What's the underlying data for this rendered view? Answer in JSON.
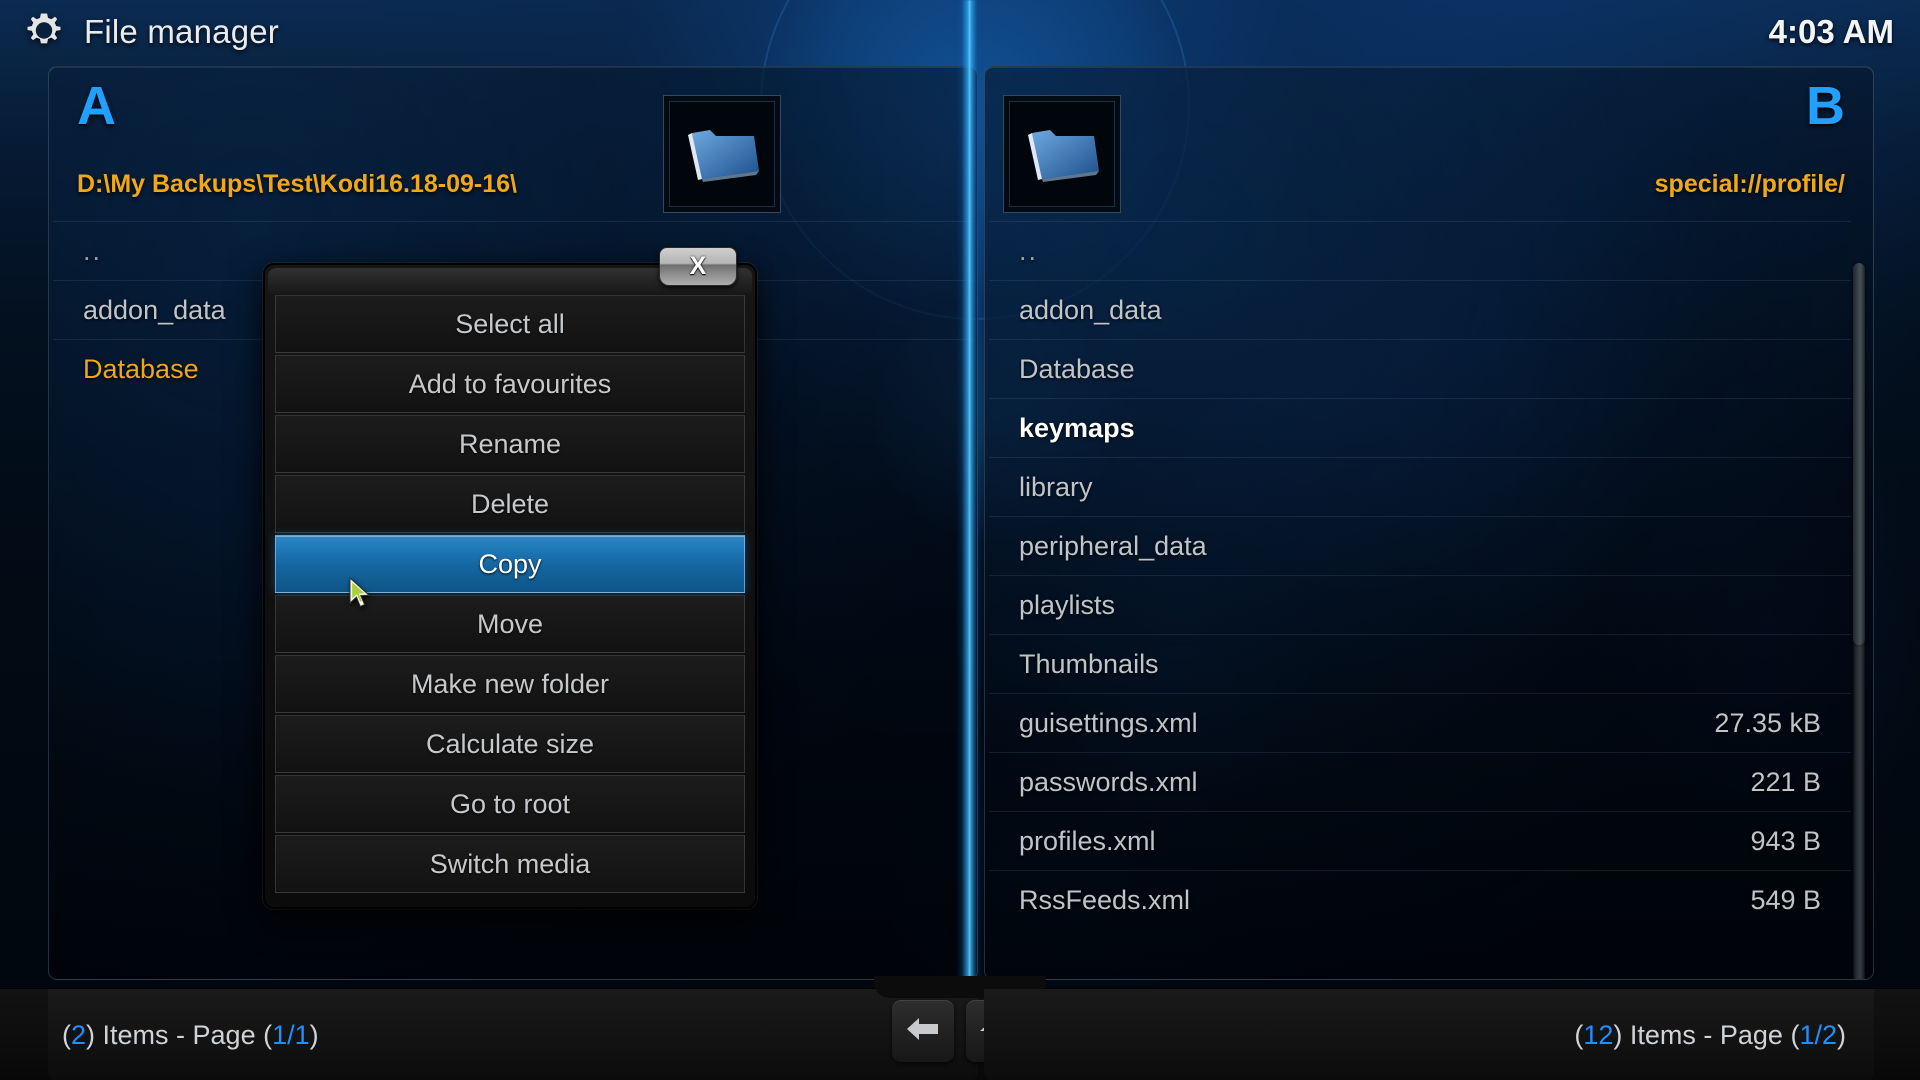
{
  "header": {
    "title": "File manager",
    "icon": "gear-icon",
    "clock": "4:03 AM"
  },
  "panels": {
    "left": {
      "letter": "A",
      "path": "D:\\My Backups\\Test\\Kodi16.18-09-16\\",
      "folder_icon": "folder-icon",
      "items": [
        {
          "name": "..",
          "size": "",
          "state": "normal"
        },
        {
          "name": "addon_data",
          "size": "",
          "state": "normal"
        },
        {
          "name": "Database",
          "size": "",
          "state": "marked"
        }
      ],
      "status": {
        "count": "2",
        "items_label": "Items - Page",
        "page": "1/1"
      }
    },
    "right": {
      "letter": "B",
      "path": "special://profile/",
      "folder_icon": "folder-icon",
      "items": [
        {
          "name": "..",
          "size": "",
          "state": "normal"
        },
        {
          "name": "addon_data",
          "size": "",
          "state": "normal"
        },
        {
          "name": "Database",
          "size": "",
          "state": "normal"
        },
        {
          "name": "keymaps",
          "size": "",
          "state": "focused"
        },
        {
          "name": "library",
          "size": "",
          "state": "normal"
        },
        {
          "name": "peripheral_data",
          "size": "",
          "state": "normal"
        },
        {
          "name": "playlists",
          "size": "",
          "state": "normal"
        },
        {
          "name": "Thumbnails",
          "size": "",
          "state": "normal"
        },
        {
          "name": "guisettings.xml",
          "size": "27.35 kB",
          "state": "normal"
        },
        {
          "name": "passwords.xml",
          "size": "221 B",
          "state": "normal"
        },
        {
          "name": "profiles.xml",
          "size": "943 B",
          "state": "normal"
        },
        {
          "name": "RssFeeds.xml",
          "size": "549 B",
          "state": "normal"
        }
      ],
      "status": {
        "count": "12",
        "items_label": "Items - Page",
        "page": "1/2"
      }
    }
  },
  "context_menu": {
    "close_label": "X",
    "items": [
      {
        "label": "Select all",
        "selected": false
      },
      {
        "label": "Add to favourites",
        "selected": false
      },
      {
        "label": "Rename",
        "selected": false
      },
      {
        "label": "Delete",
        "selected": false
      },
      {
        "label": "Copy",
        "selected": true
      },
      {
        "label": "Move",
        "selected": false
      },
      {
        "label": "Make new folder",
        "selected": false
      },
      {
        "label": "Calculate size",
        "selected": false
      },
      {
        "label": "Go to root",
        "selected": false
      },
      {
        "label": "Switch media",
        "selected": false
      }
    ]
  },
  "nav": {
    "back_icon": "back-arrow-icon",
    "home_icon": "home-icon"
  },
  "colors": {
    "accent_blue": "#22a0ff",
    "path_orange": "#f0a818",
    "selection_blue": "#1f79b8",
    "text_grey": "#bfc4c8"
  }
}
